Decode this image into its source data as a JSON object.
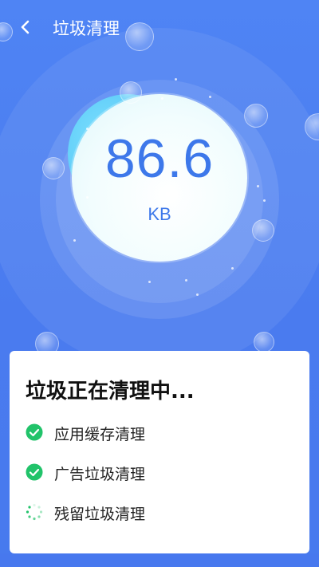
{
  "header": {
    "title": "垃圾清理",
    "back_icon": "chevron-left-icon"
  },
  "scan": {
    "value": "86.6",
    "unit": "KB"
  },
  "card": {
    "title": "垃圾正在清理中...",
    "tasks": [
      {
        "label": "应用缓存清理",
        "status": "done",
        "icon": "check-circle-icon"
      },
      {
        "label": "广告垃圾清理",
        "status": "done",
        "icon": "check-circle-icon"
      },
      {
        "label": "残留垃圾清理",
        "status": "in-progress",
        "icon": "spinner-icon"
      }
    ]
  },
  "colors": {
    "background": "#4a7cf0",
    "accent_text": "#3d78ea",
    "check_green": "#21c36a"
  }
}
